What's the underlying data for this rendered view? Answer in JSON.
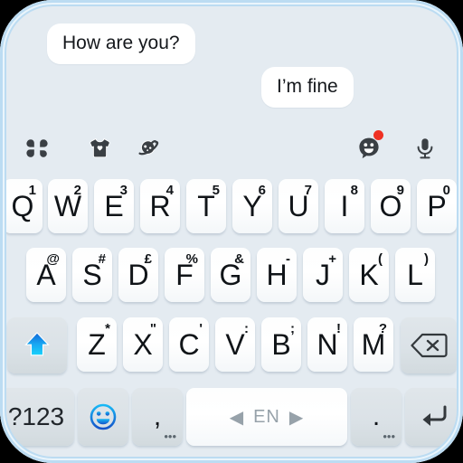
{
  "theme": {
    "frame_border_color": "#bcdcf2",
    "background_color": "#e4ebf1",
    "key_letter_color": "#ffffff",
    "key_function_color": "#dbe2e7",
    "text_color": "#101418",
    "accent_color": "#16a7f5",
    "badge_color": "#ef3124",
    "space_hint_color": "#97a2aa"
  },
  "chat": {
    "messages": [
      {
        "text": "How are you?",
        "side": "incoming"
      },
      {
        "text": "I’m fine",
        "side": "outgoing"
      }
    ]
  },
  "toolbar": {
    "items": [
      {
        "name": "menu-icon",
        "label": "Menu"
      },
      {
        "name": "tshirt-icon",
        "label": "Theme"
      },
      {
        "name": "planet-icon",
        "label": "Stickers"
      },
      {
        "name": "emoji-icon",
        "label": "Emoji",
        "badge": true
      },
      {
        "name": "microphone-icon",
        "label": "Voice input"
      }
    ]
  },
  "keyboard": {
    "rows": [
      {
        "id": "row1",
        "keys": [
          {
            "main": "Q",
            "sup": "1"
          },
          {
            "main": "W",
            "sup": "2"
          },
          {
            "main": "E",
            "sup": "3"
          },
          {
            "main": "R",
            "sup": "4"
          },
          {
            "main": "T",
            "sup": "5"
          },
          {
            "main": "Y",
            "sup": "6"
          },
          {
            "main": "U",
            "sup": "7"
          },
          {
            "main": "I",
            "sup": "8"
          },
          {
            "main": "O",
            "sup": "9"
          },
          {
            "main": "P",
            "sup": "0"
          }
        ]
      },
      {
        "id": "row2",
        "keys": [
          {
            "main": "A",
            "sup": "@"
          },
          {
            "main": "S",
            "sup": "#"
          },
          {
            "main": "D",
            "sup": "£"
          },
          {
            "main": "F",
            "sup": "%"
          },
          {
            "main": "G",
            "sup": "&"
          },
          {
            "main": "H",
            "sup": "-"
          },
          {
            "main": "J",
            "sup": "+"
          },
          {
            "main": "K",
            "sup": "("
          },
          {
            "main": "L",
            "sup": ")"
          }
        ]
      },
      {
        "id": "row3",
        "keys": [
          {
            "main": "",
            "icon": "shift-icon",
            "label": "Shift"
          },
          {
            "main": "Z",
            "sup": "*"
          },
          {
            "main": "X",
            "sup": "\""
          },
          {
            "main": "C",
            "sup": "'"
          },
          {
            "main": "V",
            "sup": ":"
          },
          {
            "main": "B",
            "sup": ";"
          },
          {
            "main": "N",
            "sup": "!"
          },
          {
            "main": "M",
            "sup": "?"
          },
          {
            "main": "",
            "icon": "backspace-icon",
            "label": "Backspace"
          }
        ]
      },
      {
        "id": "row4",
        "keys": [
          {
            "main": "?123",
            "label": "Symbols"
          },
          {
            "main": "",
            "icon": "emoji-key-icon",
            "label": "Emoji"
          },
          {
            "main": ",",
            "sub": "•••",
            "label": "Comma"
          },
          {
            "main": "EN",
            "label": "Space",
            "left_arrow": "◀",
            "right_arrow": "▶"
          },
          {
            "main": ".",
            "sub": "•••",
            "label": "Period"
          },
          {
            "main": "",
            "icon": "enter-icon",
            "label": "Enter"
          }
        ]
      }
    ]
  }
}
